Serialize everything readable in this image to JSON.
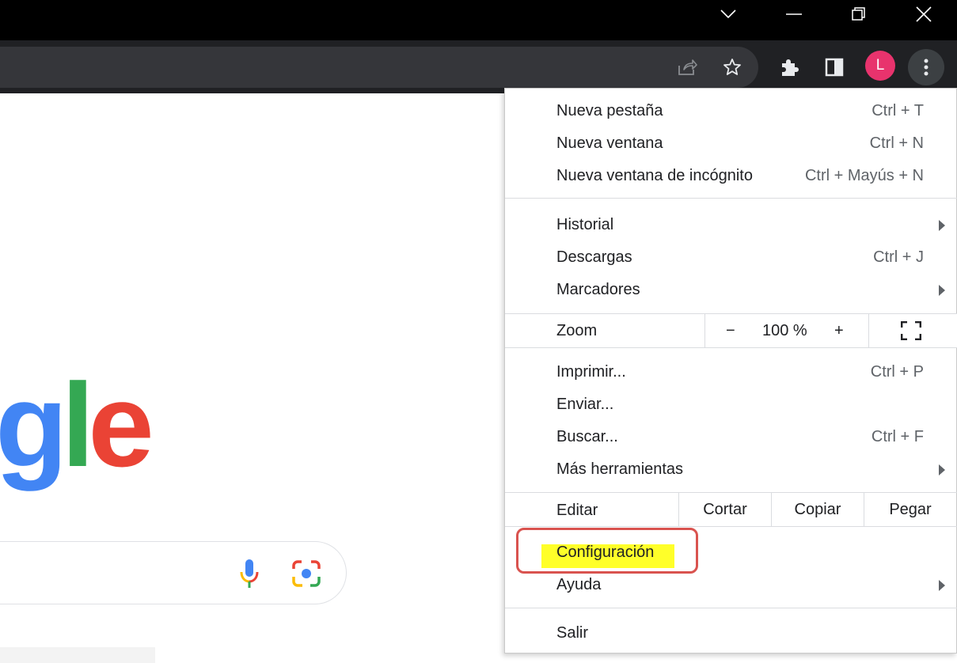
{
  "window": {
    "controls": [
      "tab-search",
      "minimize",
      "restore",
      "close"
    ]
  },
  "toolbar": {
    "profile_initial": "L",
    "icons": [
      "share-icon",
      "bookmark-star-icon",
      "extensions-icon",
      "side-panel-icon",
      "kebab-menu-icon"
    ]
  },
  "page": {
    "logo_partial": [
      "g",
      "l",
      "e"
    ],
    "colors": {
      "blue": "#4285f4",
      "green": "#34a853",
      "red": "#ea4335",
      "yellow": "#fbbc05"
    }
  },
  "menu": {
    "new_tab": {
      "label": "Nueva pestaña",
      "shortcut": "Ctrl + T"
    },
    "new_window": {
      "label": "Nueva ventana",
      "shortcut": "Ctrl + N"
    },
    "incognito": {
      "label": "Nueva ventana de incógnito",
      "shortcut": "Ctrl + Mayús + N"
    },
    "history": {
      "label": "Historial"
    },
    "downloads": {
      "label": "Descargas",
      "shortcut": "Ctrl + J"
    },
    "bookmarks": {
      "label": "Marcadores"
    },
    "zoom": {
      "label": "Zoom",
      "minus": "−",
      "value": "100 %",
      "plus": "+"
    },
    "print": {
      "label": "Imprimir...",
      "shortcut": "Ctrl + P"
    },
    "cast": {
      "label": "Enviar..."
    },
    "find": {
      "label": "Buscar...",
      "shortcut": "Ctrl + F"
    },
    "more_tools": {
      "label": "Más herramientas"
    },
    "edit": {
      "label": "Editar",
      "cut": "Cortar",
      "copy": "Copiar",
      "paste": "Pegar"
    },
    "settings": {
      "label": "Configuración",
      "highlight_color": "#ffff29",
      "callout_color": "#d9534f"
    },
    "help": {
      "label": "Ayuda"
    },
    "exit": {
      "label": "Salir"
    }
  }
}
